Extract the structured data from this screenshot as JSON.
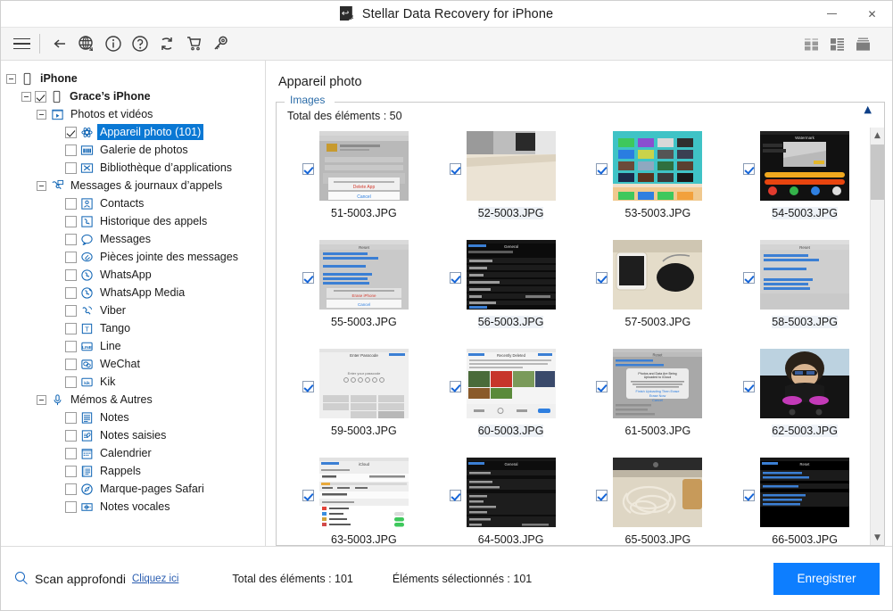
{
  "window": {
    "title": "Stellar Data Recovery for iPhone",
    "app_icon": "stellar-logo-icon",
    "minimize_label": "—",
    "close_label": "✕"
  },
  "toolbar": {
    "menu_icon": "hamburger-menu-icon",
    "buttons": [
      {
        "name": "back-icon",
        "glyph": "←",
        "title": "Retour"
      },
      {
        "name": "globe-icon",
        "glyph": "⊕",
        "title": "Langue"
      },
      {
        "name": "info-icon",
        "glyph": "ⓘ",
        "title": "Informations"
      },
      {
        "name": "help-icon",
        "glyph": "?",
        "title": "Aide"
      },
      {
        "name": "refresh-icon",
        "glyph": "↻",
        "title": "Actualiser"
      },
      {
        "name": "cart-icon",
        "glyph": "⛒",
        "title": "Acheter"
      },
      {
        "name": "key-icon",
        "glyph": "⚷",
        "title": "Activer"
      }
    ],
    "view_modes": [
      {
        "name": "view-grid-icon",
        "label": "Grille"
      },
      {
        "name": "view-list-icon",
        "label": "Liste"
      },
      {
        "name": "view-detail-icon",
        "label": "Détails"
      }
    ]
  },
  "sidebar": {
    "items": [
      {
        "label": "iPhone",
        "level": 0,
        "bold": true,
        "expander": true,
        "checkbox": "none",
        "icon": "phone-icon"
      },
      {
        "label": "Grace’s iPhone",
        "level": 1,
        "bold": true,
        "expander": true,
        "checkbox": "checked",
        "icon": "phone-icon"
      },
      {
        "label": "Photos et vidéos",
        "level": 2,
        "bold": false,
        "expander": true,
        "checkbox": "none",
        "icon": "photos-videos-icon"
      },
      {
        "label": "Appareil photo (101)",
        "level": 3,
        "bold": false,
        "expander": false,
        "checkbox": "checked",
        "icon": "camera-roll-icon",
        "selected": true
      },
      {
        "label": "Galerie de photos",
        "level": 3,
        "bold": false,
        "expander": false,
        "checkbox": "unchecked",
        "icon": "photo-gallery-icon"
      },
      {
        "label": "Bibliothèque d’applications",
        "level": 3,
        "bold": false,
        "expander": false,
        "checkbox": "unchecked",
        "icon": "app-library-icon"
      },
      {
        "label": "Messages & journaux d’appels",
        "level": 2,
        "bold": false,
        "expander": true,
        "checkbox": "none",
        "icon": "messages-calls-icon"
      },
      {
        "label": "Contacts",
        "level": 3,
        "bold": false,
        "expander": false,
        "checkbox": "unchecked",
        "icon": "contacts-icon"
      },
      {
        "label": "Historique des appels",
        "level": 3,
        "bold": false,
        "expander": false,
        "checkbox": "unchecked",
        "icon": "call-history-icon"
      },
      {
        "label": "Messages",
        "level": 3,
        "bold": false,
        "expander": false,
        "checkbox": "unchecked",
        "icon": "messages-icon"
      },
      {
        "label": "Pièces jointe des messages",
        "level": 3,
        "bold": false,
        "expander": false,
        "checkbox": "unchecked",
        "icon": "message-attachments-icon"
      },
      {
        "label": "WhatsApp",
        "level": 3,
        "bold": false,
        "expander": false,
        "checkbox": "unchecked",
        "icon": "whatsapp-icon"
      },
      {
        "label": "WhatsApp Media",
        "level": 3,
        "bold": false,
        "expander": false,
        "checkbox": "unchecked",
        "icon": "whatsapp-media-icon"
      },
      {
        "label": "Viber",
        "level": 3,
        "bold": false,
        "expander": false,
        "checkbox": "unchecked",
        "icon": "viber-icon"
      },
      {
        "label": "Tango",
        "level": 3,
        "bold": false,
        "expander": false,
        "checkbox": "unchecked",
        "icon": "tango-icon"
      },
      {
        "label": "Line",
        "level": 3,
        "bold": false,
        "expander": false,
        "checkbox": "unchecked",
        "icon": "line-icon"
      },
      {
        "label": "WeChat",
        "level": 3,
        "bold": false,
        "expander": false,
        "checkbox": "unchecked",
        "icon": "wechat-icon"
      },
      {
        "label": "Kik",
        "level": 3,
        "bold": false,
        "expander": false,
        "checkbox": "unchecked",
        "icon": "kik-icon"
      },
      {
        "label": "Mémos & Autres",
        "level": 2,
        "bold": false,
        "expander": true,
        "checkbox": "none",
        "icon": "microphone-icon"
      },
      {
        "label": "Notes",
        "level": 3,
        "bold": false,
        "expander": false,
        "checkbox": "unchecked",
        "icon": "notes-icon"
      },
      {
        "label": "Notes saisies",
        "level": 3,
        "bold": false,
        "expander": false,
        "checkbox": "unchecked",
        "icon": "typed-notes-icon"
      },
      {
        "label": "Calendrier",
        "level": 3,
        "bold": false,
        "expander": false,
        "checkbox": "unchecked",
        "icon": "calendar-icon"
      },
      {
        "label": "Rappels",
        "level": 3,
        "bold": false,
        "expander": false,
        "checkbox": "unchecked",
        "icon": "reminders-icon"
      },
      {
        "label": "Marque-pages Safari",
        "level": 3,
        "bold": false,
        "expander": false,
        "checkbox": "unchecked",
        "icon": "safari-bookmarks-icon"
      },
      {
        "label": "Notes vocales",
        "level": 3,
        "bold": false,
        "expander": false,
        "checkbox": "unchecked",
        "icon": "voice-memos-icon"
      }
    ]
  },
  "main": {
    "title": "Appareil photo",
    "group_legend": "Images",
    "total_items_label": "Total des éléments : 50",
    "collapse_icon": "chevron-up-icon",
    "scrollbar": {
      "up_icon": "chevron-up-icon",
      "down_icon": "chevron-down-icon"
    },
    "thumbnails": [
      {
        "filename": "51-5003.JPG",
        "checked": true,
        "kind": "ios-dialog-light",
        "highlight": false
      },
      {
        "filename": "52-5003.JPG",
        "checked": true,
        "kind": "photo-desk",
        "highlight": true
      },
      {
        "filename": "53-5003.JPG",
        "checked": true,
        "kind": "ios-homescreen",
        "highlight": false
      },
      {
        "filename": "54-5003.JPG",
        "checked": true,
        "kind": "ios-dark-app",
        "highlight": true
      },
      {
        "filename": "55-5003.JPG",
        "checked": true,
        "kind": "ios-reset-light",
        "highlight": false
      },
      {
        "filename": "56-5003.JPG",
        "checked": true,
        "kind": "ios-settings-dark",
        "highlight": true
      },
      {
        "filename": "57-5003.JPG",
        "checked": true,
        "kind": "photo-phone-mouse",
        "highlight": false
      },
      {
        "filename": "58-5003.JPG",
        "checked": true,
        "kind": "ios-reset-light2",
        "highlight": true
      },
      {
        "filename": "59-5003.JPG",
        "checked": true,
        "kind": "ios-passcode",
        "highlight": false
      },
      {
        "filename": "60-5003.JPG",
        "checked": true,
        "kind": "ios-photo-grid",
        "highlight": true
      },
      {
        "filename": "61-5003.JPG",
        "checked": true,
        "kind": "ios-alert-dialog",
        "highlight": false
      },
      {
        "filename": "62-5003.JPG",
        "checked": true,
        "kind": "photo-person-dark",
        "highlight": true
      },
      {
        "filename": "63-5003.JPG",
        "checked": true,
        "kind": "ios-icloud-settings",
        "highlight": false
      },
      {
        "filename": "64-5003.JPG",
        "checked": true,
        "kind": "ios-general-dark",
        "highlight": false
      },
      {
        "filename": "65-5003.JPG",
        "checked": true,
        "kind": "photo-cables",
        "highlight": false
      },
      {
        "filename": "66-5003.JPG",
        "checked": true,
        "kind": "ios-reset-black",
        "highlight": false
      }
    ]
  },
  "footer": {
    "deep_scan_icon": "magnifier-icon",
    "deep_scan_label": "Scan approfondi",
    "deep_scan_link": "Cliquez ici",
    "total_items": "Total des éléments : 101",
    "selected_items": "Éléments sélectionnés : 101",
    "save_button": "Enregistrer"
  },
  "colors": {
    "accent_blue": "#0d7eff",
    "selection_blue": "#0a78d4",
    "icon_blue": "#1266b5",
    "legend_blue": "#2b6ca8",
    "link_blue": "#2a5db0"
  }
}
